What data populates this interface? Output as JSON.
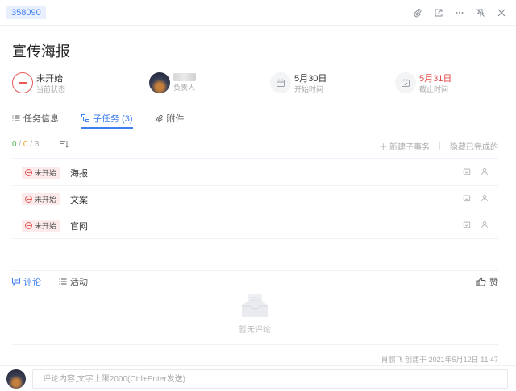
{
  "header": {
    "task_id": "358090",
    "icons": [
      "paperclip-icon",
      "open-external-icon",
      "more-icon",
      "pin-off-icon",
      "close-icon"
    ]
  },
  "task": {
    "title": "宣传海报"
  },
  "meta": {
    "status": {
      "value": "未开始",
      "label": "当前状态",
      "color": "#e65a5a"
    },
    "assignee": {
      "value": "",
      "label": "负责人"
    },
    "start": {
      "value": "5月30日",
      "label": "开始时间"
    },
    "deadline": {
      "value": "5月31日",
      "label": "截止时间",
      "color": "#e64b4b"
    }
  },
  "tabs": [
    {
      "label": "任务信息",
      "icon": "list-icon"
    },
    {
      "label": "子任务 (3)",
      "icon": "subtask-icon",
      "active": true
    },
    {
      "label": "附件",
      "icon": "paperclip-icon"
    }
  ],
  "subtasks_toolbar": {
    "done": "0",
    "sep1": "/",
    "active": "0",
    "sep2": "/",
    "total": "3",
    "new_label": "新建子事务",
    "hide_label": "隐藏已完成的"
  },
  "subtasks": [
    {
      "status": "未开始",
      "name": "海报"
    },
    {
      "status": "未开始",
      "name": "文案"
    },
    {
      "status": "未开始",
      "name": "官网"
    }
  ],
  "comment_tabs": [
    {
      "label": "评论",
      "active": true
    },
    {
      "label": "活动"
    }
  ],
  "like_label": "赞",
  "empty_text": "暂无评论",
  "created_text": "肖鹏飞 创建于 2021年5月12日 11:47",
  "comment_input": {
    "placeholder": "评论内容,文字上限2000(Ctrl+Enter发送)"
  },
  "colors": {
    "accent": "#3f7ff0",
    "status_red": "#e65a5a"
  }
}
